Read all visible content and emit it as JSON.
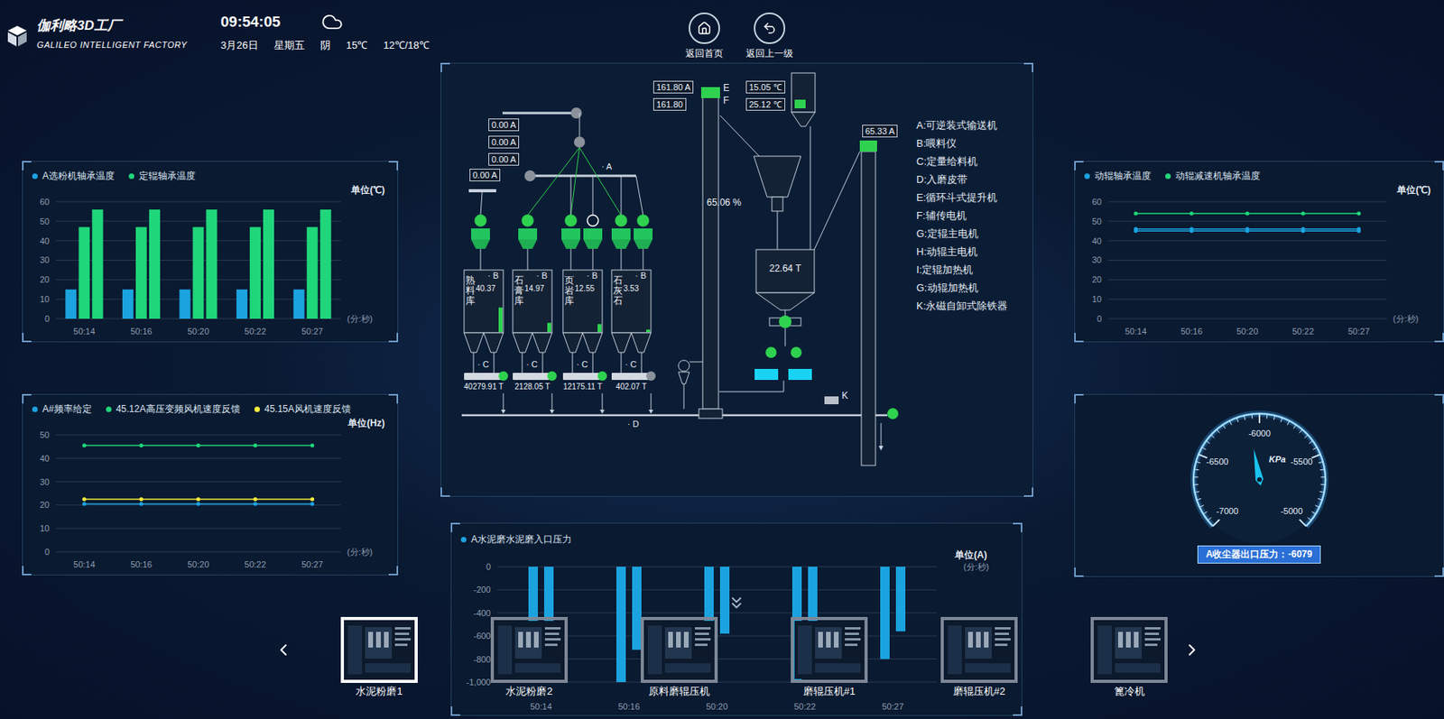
{
  "header": {
    "title": "伽利略3D工厂",
    "subtitle": "GALILEO INTELLIGENT FACTORY",
    "time": "09:54:05",
    "date": "3月26日",
    "weekday": "星期五",
    "weather": "阴",
    "temperature": "15℃",
    "range": "12℃/18℃"
  },
  "nav": [
    {
      "label": "返回首页",
      "icon": "home"
    },
    {
      "label": "返回上一级",
      "icon": "back"
    }
  ],
  "bearingChart": {
    "legend": [
      {
        "label": "A选粉机轴承温度",
        "color": "#1ba3e0"
      },
      {
        "label": "定辊轴承温度",
        "color": "#1fd67a"
      }
    ],
    "unit": "单位(℃)",
    "axisUnit": "(分:秒)",
    "ticks": [
      "60",
      "50",
      "40",
      "30",
      "20",
      "10",
      "0"
    ],
    "max": 60,
    "min": 0,
    "categories": [
      "50:14",
      "50:16",
      "50:20",
      "50:22",
      "50:27"
    ],
    "series": [
      {
        "color": "#1ba3e0",
        "values": [
          15,
          15,
          15,
          15,
          15
        ]
      },
      {
        "color": "#1fd67a",
        "values": [
          47,
          47,
          47,
          47,
          47
        ]
      },
      {
        "color": "#1fd67a",
        "values": [
          56,
          56,
          56,
          56,
          56
        ]
      }
    ]
  },
  "frequencyChart": {
    "legend": [
      {
        "label": "A#频率给定",
        "color": "#1ba3e0"
      },
      {
        "label": "45.12A高压变频风机速度反馈",
        "color": "#1fd67a"
      },
      {
        "label": "45.15A风机速度反馈",
        "color": "#f2ea3c"
      }
    ],
    "unit": "单位(Hz)",
    "axisUnit": "(分:秒)",
    "ticks": [
      "50",
      "40",
      "30",
      "20",
      "10",
      "0"
    ],
    "max": 50,
    "min": 0,
    "categories": [
      "50:14",
      "50:16",
      "50:20",
      "50:22",
      "50:27"
    ],
    "series": [
      {
        "color": "#1ba3e0",
        "values": [
          20.5,
          20.5,
          20.5,
          20.5,
          20.5
        ]
      },
      {
        "color": "#1fd67a",
        "values": [
          45.5,
          45.5,
          45.5,
          45.5,
          45.5
        ]
      },
      {
        "color": "#f2ea3c",
        "values": [
          22.5,
          22.5,
          22.5,
          22.5,
          22.5
        ]
      }
    ]
  },
  "rollerChart": {
    "legend": [
      {
        "label": "动辊轴承温度",
        "color": "#1ba3e0"
      },
      {
        "label": "动辊减速机轴承温度",
        "color": "#1fd67a"
      }
    ],
    "unit": "单位(℃)",
    "axisUnit": "(分:秒)",
    "ticks": [
      "60",
      "50",
      "40",
      "30",
      "20",
      "10",
      "0"
    ],
    "max": 60,
    "min": 0,
    "categories": [
      "50:14",
      "50:16",
      "50:20",
      "50:22",
      "50:27"
    ],
    "series": [
      {
        "color": "#1fd67a",
        "values": [
          54,
          54,
          54,
          54,
          54
        ]
      },
      {
        "color": "#1ba3e0",
        "values": [
          46,
          46,
          46,
          46,
          46
        ]
      },
      {
        "color": "#1ba3e0",
        "values": [
          45,
          45,
          45,
          45,
          45
        ]
      }
    ]
  },
  "pressureGauge": {
    "unit": "KPa",
    "ticks": [
      "-7000",
      "-6500",
      "-6000",
      "-5500",
      "-5000"
    ],
    "min": -7000,
    "max": -5000,
    "value": -6079,
    "label": "A收尘器出口压力：-6079"
  },
  "pressureChart": {
    "legend": [
      {
        "label": "A水泥磨水泥磨入口压力",
        "color": "#1ba3e0"
      }
    ],
    "unit": "单位(A)",
    "axisUnit": "(分:秒)",
    "ticks": [
      "0",
      "-200",
      "-400",
      "-600",
      "-800",
      "-1,000"
    ],
    "max": 0,
    "min": -1000,
    "categories": [
      "50:14",
      "50:16",
      "50:20",
      "50:22",
      "50:27"
    ],
    "series": [
      {
        "color": "#1ba3e0",
        "values": [
          -580,
          -1000,
          -580,
          -980,
          -800
        ]
      },
      {
        "color": "#1ba3e0",
        "values": [
          -580,
          -720,
          -580,
          -700,
          -560
        ]
      }
    ]
  },
  "diagram": {
    "currents": [
      "0.00 A",
      "0.00 A",
      "0.00 A",
      "0.00 A"
    ],
    "conveyorTag": "· A",
    "feeders": [
      {
        "running": true
      },
      {
        "running": true
      },
      {
        "running": true
      },
      {
        "running": false
      },
      {
        "running": true
      },
      {
        "running": true
      }
    ],
    "silos": [
      {
        "name": "熟料库",
        "reading": "40.37",
        "level": 0.4,
        "tag": "· B",
        "feederTag": "· C",
        "weight": "40279.91 T",
        "feederRunning": true
      },
      {
        "name": "石膏库",
        "reading": "14.97",
        "level": 0.15,
        "tag": "· B",
        "feederTag": "· C",
        "weight": "2128.05 T",
        "feederRunning": true
      },
      {
        "name": "页岩库",
        "reading": "12.55",
        "level": 0.13,
        "tag": "· B",
        "feederTag": "· C",
        "weight": "12175.11 T",
        "feederRunning": true
      },
      {
        "name": "石灰石",
        "reading": "3.53",
        "level": 0.04,
        "tag": "· B",
        "feederTag": "· C",
        "weight": "402.07 T",
        "feederRunning": false
      }
    ],
    "beltTag": "· D",
    "elevator": {
      "current": "161.80 A",
      "reading": "161.80",
      "tagE": "E",
      "tagF": "F",
      "running": true
    },
    "temperatures": [
      "15.05 ℃",
      "25.12 ℃"
    ],
    "separator": "65.06 %",
    "bin": "22.64 T",
    "returnElevator": {
      "current": "65.33 A",
      "running": true
    },
    "ironRemover": "K",
    "beltMotorRunning": true,
    "mill": {
      "motorRunning": true,
      "rollers": [
        {
          "running": true
        },
        {
          "running": true
        }
      ]
    },
    "legend": [
      "A:可逆装式输送机",
      "B:喂料仪",
      "C:定量给料机",
      "D:入磨皮带",
      "E:循环斗式提升机",
      "F:辅传电机",
      "G:定辊主电机",
      "H:动辊主电机",
      "I:定辊加热机",
      "G:动辊加热机",
      "K:永磁自卸式除铁器"
    ]
  },
  "carousel": {
    "items": [
      {
        "label": "水泥粉磨1",
        "selected": true
      },
      {
        "label": "水泥粉磨2",
        "selected": false
      },
      {
        "label": "原料磨辊压机",
        "selected": false
      },
      {
        "label": "磨辊压机#1",
        "selected": false
      },
      {
        "label": "磨辊压机#2",
        "selected": false
      },
      {
        "label": "篦冷机",
        "selected": false
      }
    ]
  }
}
